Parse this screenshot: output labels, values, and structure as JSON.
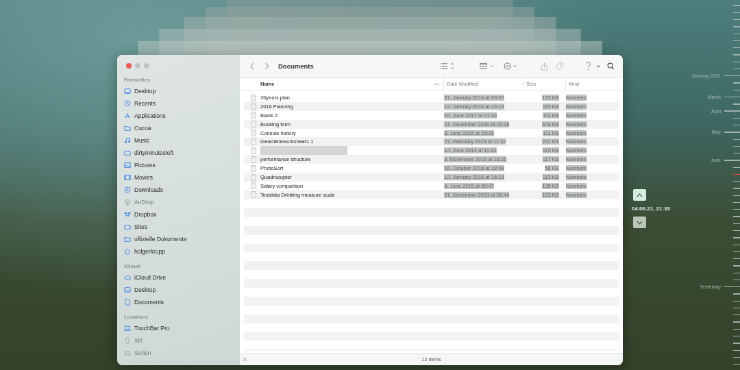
{
  "window": {
    "title": "Documents",
    "status": "12 items"
  },
  "sidebar": {
    "sections": [
      {
        "title": "Favourites",
        "items": [
          {
            "label": "Desktop",
            "kind": "desktop",
            "disabled": false
          },
          {
            "label": "Recents",
            "kind": "clock",
            "disabled": false
          },
          {
            "label": "Applications",
            "kind": "apps",
            "disabled": false
          },
          {
            "label": "Cocoa",
            "kind": "folder",
            "disabled": false
          },
          {
            "label": "Music",
            "kind": "music",
            "disabled": false
          },
          {
            "label": "dirtyminutesleft",
            "kind": "folder",
            "disabled": false
          },
          {
            "label": "Pictures",
            "kind": "pictures",
            "disabled": false
          },
          {
            "label": "Movies",
            "kind": "movies",
            "disabled": false
          },
          {
            "label": "Downloads",
            "kind": "download",
            "disabled": false
          },
          {
            "label": "AirDrop",
            "kind": "airdrop",
            "disabled": true
          },
          {
            "label": "Dropbox",
            "kind": "dropbox",
            "disabled": false
          },
          {
            "label": "Sites",
            "kind": "folder",
            "disabled": false
          },
          {
            "label": "offizielle Dokumente",
            "kind": "folder",
            "disabled": false
          },
          {
            "label": "holgerkrupp",
            "kind": "home",
            "disabled": false
          }
        ]
      },
      {
        "title": "iCloud",
        "items": [
          {
            "label": "iCloud Drive",
            "kind": "cloud",
            "disabled": false
          },
          {
            "label": "Desktop",
            "kind": "desktop",
            "disabled": false
          },
          {
            "label": "Documents",
            "kind": "document",
            "disabled": false
          }
        ]
      },
      {
        "title": "Locations",
        "items": [
          {
            "label": "TouchBar Pro",
            "kind": "laptop",
            "disabled": false
          },
          {
            "label": "XR",
            "kind": "phone",
            "disabled": true
          },
          {
            "label": "Serien",
            "kind": "drive",
            "disabled": true
          }
        ]
      }
    ]
  },
  "table": {
    "columns": [
      {
        "label": "Name",
        "sorted": true
      },
      {
        "label": "Date Modified",
        "sorted": false
      },
      {
        "label": "Size",
        "sorted": false
      },
      {
        "label": "Kind",
        "sorted": false
      }
    ],
    "rows": [
      {
        "name": "20years plan",
        "redacted": false,
        "date": "21. January 2014 at 09:07",
        "size": "172 KB",
        "kind": "Numbers"
      },
      {
        "name": "2016 Planning",
        "redacted": false,
        "date": "12. January 2016 at 16:19",
        "size": "115 KB",
        "kind": "Numbers"
      },
      {
        "name": "Blank 2",
        "redacted": false,
        "date": "10. June 2017 at 21:33",
        "size": "111 KB",
        "kind": "Numbers"
      },
      {
        "name": "Booking form",
        "redacted": false,
        "date": "21. December 2016 at 16:39",
        "size": "678 KB",
        "kind": "Numbers"
      },
      {
        "name": "Console history",
        "redacted": false,
        "date": "3. June 2015 at 16:15",
        "size": "111 KB",
        "kind": "Numbers"
      },
      {
        "name": "dreamlineworksheet1.1",
        "redacted": false,
        "date": "27. February 2015 at 11:32",
        "size": "272 KB",
        "kind": "Numbers"
      },
      {
        "redacted": true,
        "date": "14. June 2014 at 11:32",
        "size": "119 KB",
        "kind": "Numbers"
      },
      {
        "name": "performance structure",
        "redacted": false,
        "date": "8. November 2015 at 16:25",
        "size": "117 KB",
        "kind": "Numbers"
      },
      {
        "name": "PhotoSort",
        "redacted": false,
        "date": "16. October 2016 at 18:48",
        "size": "58 KB",
        "kind": "Numbers"
      },
      {
        "name": "Quadrocopter",
        "redacted": false,
        "date": "12. January 2016 at 16:18",
        "size": "113 KB",
        "kind": "Numbers"
      },
      {
        "name": "Salary comparison",
        "redacted": false,
        "date": "4. June 2015 at 09:47",
        "size": "135 KB",
        "kind": "Numbers"
      },
      {
        "name": "Testdata Drinking measure scale",
        "redacted": false,
        "date": "21. December 2013 at 06:44",
        "size": "123 KB",
        "kind": "Numbers"
      }
    ]
  },
  "time_navigation": {
    "date": "04.06.21, 21:33"
  },
  "timeline": {
    "ticks": [
      {
        "current": false
      },
      {
        "current": false
      },
      {
        "current": false
      },
      {
        "current": false
      },
      {
        "current": false
      },
      {
        "current": false
      },
      {
        "current": false
      },
      {
        "current": false
      },
      {
        "current": false
      },
      {
        "current": false
      },
      {
        "label": "January 2021",
        "current": false
      },
      {
        "current": false
      },
      {
        "current": false
      },
      {
        "label": "March",
        "current": false
      },
      {
        "current": false
      },
      {
        "label": "April",
        "current": false
      },
      {
        "current": false
      },
      {
        "current": false
      },
      {
        "label": "May",
        "current": false
      },
      {
        "current": false
      },
      {
        "current": false
      },
      {
        "current": false
      },
      {
        "label": "June",
        "current": false
      },
      {
        "current": false
      },
      {
        "current": true
      },
      {
        "current": false
      },
      {
        "current": false
      },
      {
        "current": false
      },
      {
        "current": false
      },
      {
        "current": false
      },
      {
        "current": false
      },
      {
        "current": false
      },
      {
        "current": false
      },
      {
        "current": false
      },
      {
        "current": false
      },
      {
        "current": false
      },
      {
        "current": false
      },
      {
        "current": false
      },
      {
        "current": false
      },
      {
        "current": false
      },
      {
        "label": "Yesterday",
        "current": false
      },
      {
        "current": false
      },
      {
        "current": false
      },
      {
        "current": false
      },
      {
        "current": false
      },
      {
        "current": false
      },
      {
        "current": false
      },
      {
        "current": false
      },
      {
        "current": false
      },
      {
        "current": false
      },
      {
        "current": false
      },
      {
        "current": false
      }
    ]
  }
}
